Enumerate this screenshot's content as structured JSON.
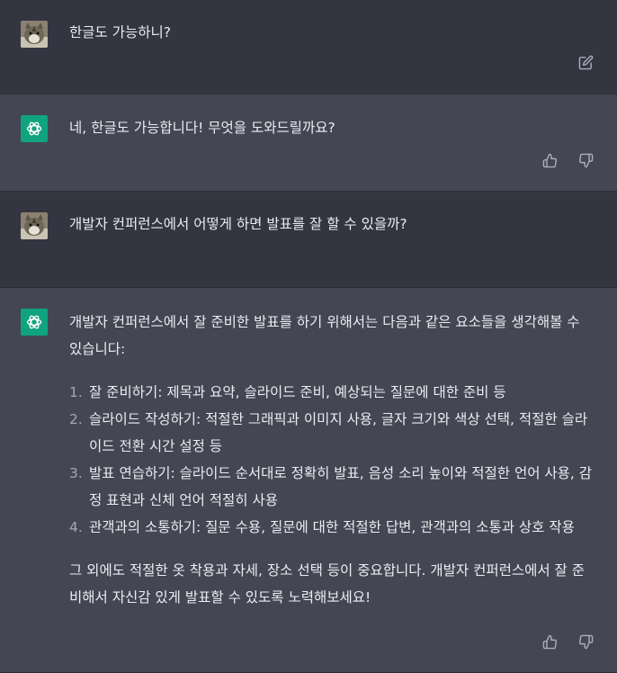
{
  "messages": [
    {
      "role": "user",
      "text": "한글도 가능하니?"
    },
    {
      "role": "assistant",
      "text": "네, 한글도 가능합니다! 무엇을 도와드릴까요?"
    },
    {
      "role": "user",
      "text": "개발자 컨퍼런스에서 어떻게 하면 발표를 잘 할 수 있을까?"
    },
    {
      "role": "assistant",
      "intro": "개발자 컨퍼런스에서 잘 준비한 발표를 하기 위해서는 다음과 같은 요소들을 생각해볼 수 있습니다:",
      "list": [
        {
          "num": "1.",
          "text": "잘 준비하기: 제목과 요약, 슬라이드 준비, 예상되는 질문에 대한 준비 등"
        },
        {
          "num": "2.",
          "text": "슬라이드 작성하기: 적절한 그래픽과 이미지 사용, 글자 크기와 색상 선택, 적절한 슬라이드 전환 시간 설정 등"
        },
        {
          "num": "3.",
          "text": "발표 연습하기: 슬라이드 순서대로 정확히 발표, 음성 소리 높이와 적절한 언어 사용, 감정 표현과 신체 언어 적절히 사용"
        },
        {
          "num": "4.",
          "text": "관객과의 소통하기: 질문 수용, 질문에 대한 적절한 답변, 관객과의 소통과 상호 작용"
        }
      ],
      "outro": "그 외에도 적절한 옷 착용과 자세, 장소 선택 등이 중요합니다. 개발자 컨퍼런스에서 잘 준비해서 자신감 있게 발표할 수 있도록 노력해보세요!"
    }
  ],
  "icons": {
    "edit": "edit-icon",
    "thumbs_up": "thumbs-up-icon",
    "thumbs_down": "thumbs-down-icon",
    "assistant_logo": "openai-logo-icon",
    "user_avatar": "user-avatar"
  },
  "colors": {
    "user_bg": "#343541",
    "assistant_bg": "#444654",
    "logo_bg": "#10a37f",
    "text": "#ececf1",
    "icon": "#acacbe"
  }
}
